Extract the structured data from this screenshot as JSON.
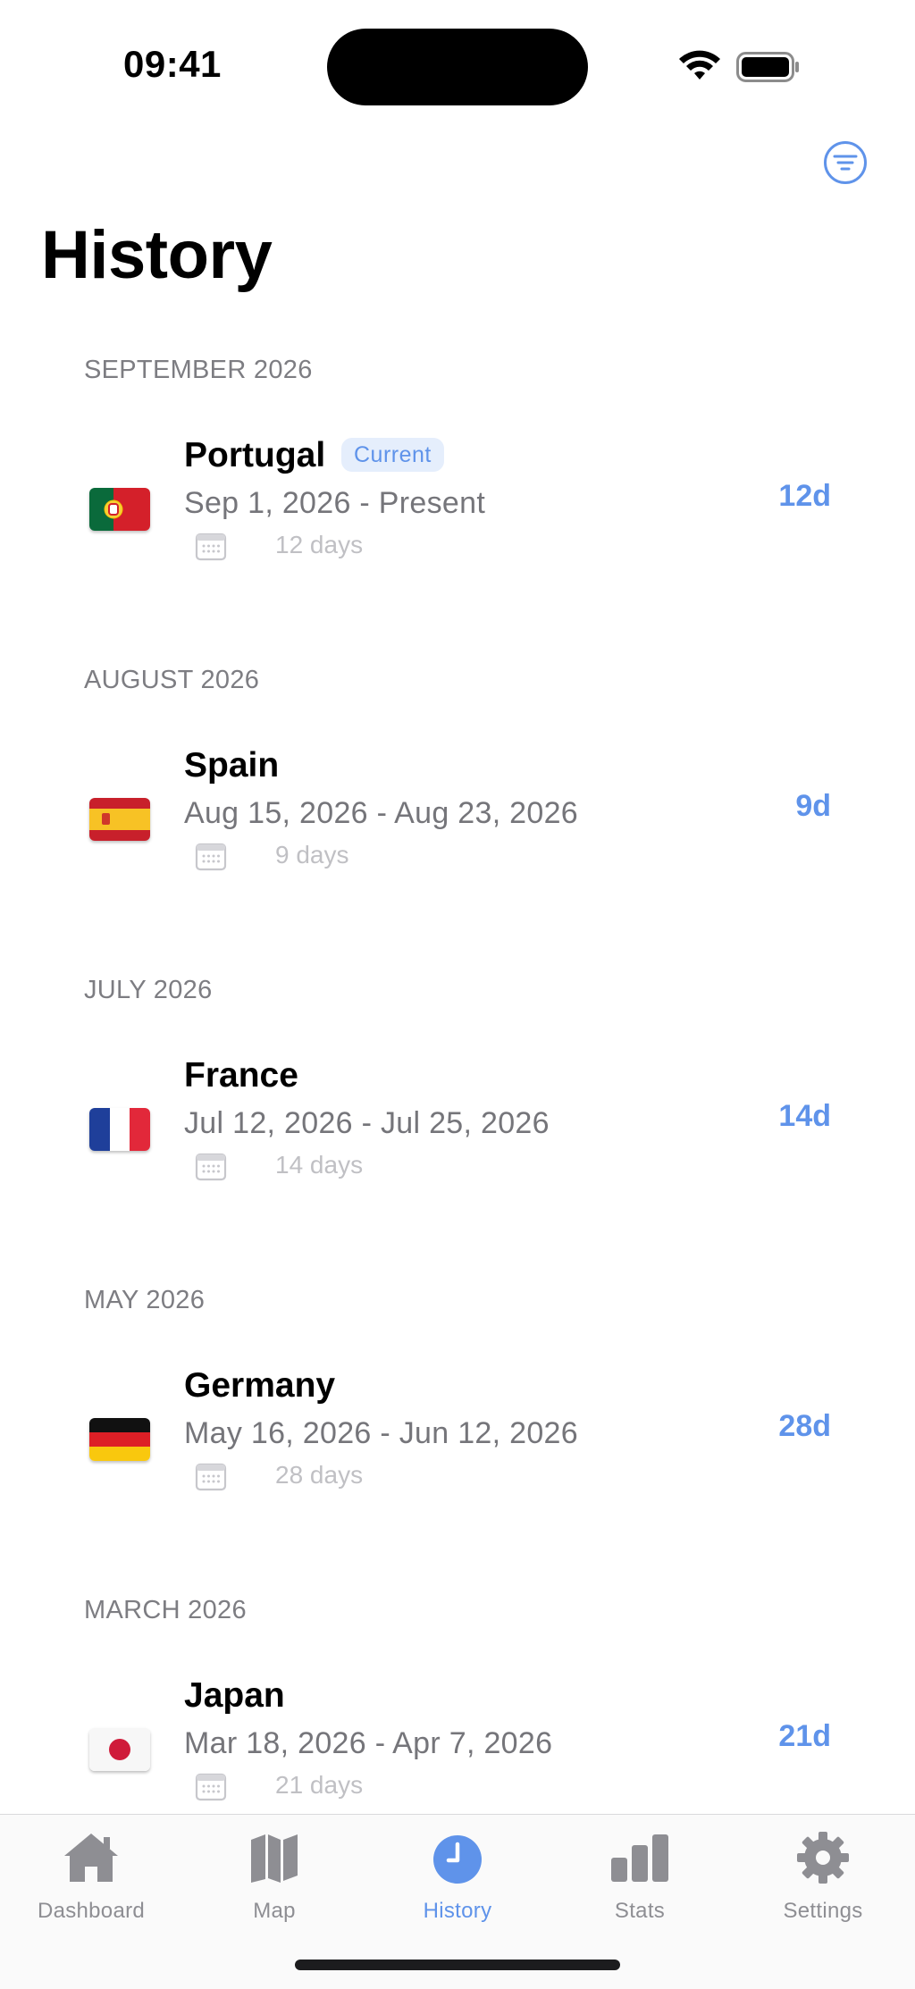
{
  "status_bar": {
    "time": "09:41"
  },
  "header": {
    "title": "History",
    "filter_icon": "filter-lines-icon"
  },
  "sections": [
    {
      "header": "SEPTEMBER 2026",
      "trip": {
        "country": "Portugal",
        "badge": "Current",
        "dates": "Sep 1, 2026 - Present",
        "days_text": "12 days",
        "duration": "12d",
        "flag": "portugal-flag"
      }
    },
    {
      "header": "AUGUST 2026",
      "trip": {
        "country": "Spain",
        "dates": "Aug 15, 2026 - Aug 23, 2026",
        "days_text": "9 days",
        "duration": "9d",
        "flag": "spain-flag"
      }
    },
    {
      "header": "JULY 2026",
      "trip": {
        "country": "France",
        "dates": "Jul 12, 2026 - Jul 25, 2026",
        "days_text": "14 days",
        "duration": "14d",
        "flag": "france-flag"
      }
    },
    {
      "header": "MAY 2026",
      "trip": {
        "country": "Germany",
        "dates": "May 16, 2026 - Jun 12, 2026",
        "days_text": "28 days",
        "duration": "28d",
        "flag": "germany-flag"
      }
    },
    {
      "header": "MARCH 2026",
      "trip": {
        "country": "Japan",
        "dates": "Mar 18, 2026 - Apr 7, 2026",
        "days_text": "21 days",
        "duration": "21d",
        "flag": "japan-flag"
      }
    }
  ],
  "tab_bar": {
    "tabs": [
      {
        "label": "Dashboard",
        "icon": "house-icon"
      },
      {
        "label": "Map",
        "icon": "map-icon"
      },
      {
        "label": "History",
        "icon": "clock-icon",
        "active": true
      },
      {
        "label": "Stats",
        "icon": "bar-chart-icon"
      },
      {
        "label": "Settings",
        "icon": "gear-icon"
      }
    ]
  },
  "colors": {
    "accent": "#5f93ea",
    "inactive": "#8e8e93",
    "secondary_text": "#75757a",
    "badge_bg": "#e5eefc"
  }
}
